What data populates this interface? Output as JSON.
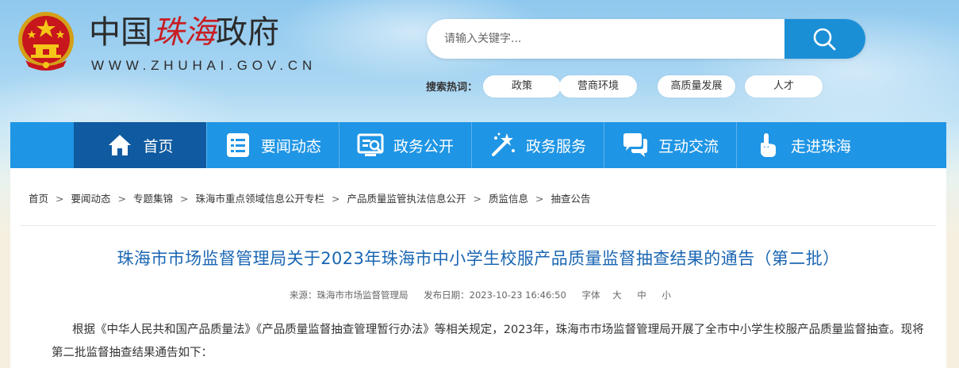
{
  "logo": {
    "part1": "中国",
    "part2": "珠海",
    "part3": "政府",
    "url": "WWW.ZHUHAI.GOV.CN"
  },
  "search": {
    "placeholder": "请输入关键字..."
  },
  "hot": {
    "label": "搜索热词：",
    "tags": [
      "政策",
      "营商环境",
      "高质量发展",
      "人才"
    ]
  },
  "nav": {
    "items": [
      {
        "label": "首页",
        "icon": "home-icon"
      },
      {
        "label": "要闻动态",
        "icon": "news-list-icon"
      },
      {
        "label": "政务公开",
        "icon": "open-affairs-icon"
      },
      {
        "label": "政务服务",
        "icon": "service-tools-icon"
      },
      {
        "label": "互动交流",
        "icon": "chat-bubbles-icon"
      },
      {
        "label": "走进珠海",
        "icon": "hand-pointer-icon"
      }
    ]
  },
  "breadcrumb": [
    "首页",
    "要闻动态",
    "专题集锦",
    "珠海市重点领域信息公开专栏",
    "产品质量监管执法信息公开",
    "质监信息",
    "抽查公告"
  ],
  "article": {
    "title": "珠海市市场监督管理局关于2023年珠海市中小学生校服产品质量监督抽查结果的通告（第二批）",
    "source": "来源：珠海市市场监督管理局",
    "date": "发布日期：2023-10-23 16:46:50",
    "font_label": "字体",
    "font_large": "大",
    "font_medium": "中",
    "font_small": "小",
    "paragraph": "根据《中华人民共和国产品质量法》《产品质量监督抽查管理暂行办法》等相关规定，2023年，珠海市市场监督管理局开展了全市中小学生校服产品质量监督抽查。现将第二批监督抽查结果通告如下："
  },
  "colors": {
    "nav_bg": "#1f95e5",
    "nav_active": "#0f5aa0",
    "title": "#1a66b3",
    "logo_red": "#c81d22"
  }
}
